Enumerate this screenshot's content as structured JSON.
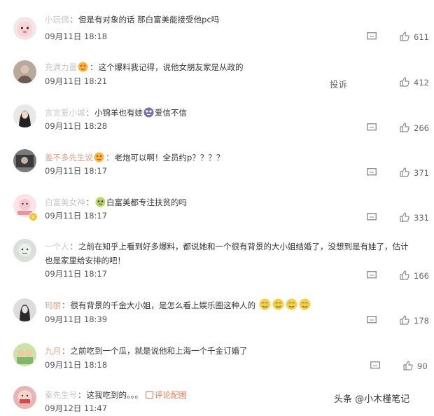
{
  "comments": [
    {
      "user": "小玩偶",
      "text": "但是有对象的话 那白富美能接受他pc吗",
      "time": "09月11日 18:18",
      "likes": "611"
    },
    {
      "user": "充满力量",
      "text": "这个爆料我记得，说他女朋友家是从政的",
      "time": "09月11日 18:21",
      "likes": "412",
      "report": "投诉"
    },
    {
      "user": "言言爱小城",
      "text_a": "小锦羊也有娃",
      "text_b": "爱信不信",
      "time": "09月11日 18:28",
      "likes": "266"
    },
    {
      "user": "差不多先生说",
      "text": "老炮可以啊！全员约p？？？？",
      "time": "09月11日 18:17",
      "likes": "371"
    },
    {
      "user": "白富美女神",
      "text": "白富美都专注扶贫的吗",
      "time": "09月11日 18:17",
      "likes": "331"
    },
    {
      "user": "一个人",
      "text": "之前在知乎上看到好多爆料，都说她和一个很有背景的大小姐结婚了，没想到是有娃了，估计也是家里给安排的吧！",
      "time": "09月11日 18:17",
      "likes": "166"
    },
    {
      "user": "玛丽",
      "text": "很有背景的千金大小姐，是怎么看上娱乐圈这种人的",
      "time": "09月11日 18:39",
      "likes": "178"
    },
    {
      "user": "九月",
      "text": "之前吃到一个瓜，就是说他和上海一个千金订婚了",
      "time": "09月11日 18:18",
      "likes": "90"
    },
    {
      "user": "秦先生号",
      "text": "这我吃到的。。。",
      "link": "评论配图",
      "time": "09月12日 11:47",
      "likes": ""
    }
  ],
  "watermark": "头条 @小木槿笔记",
  "icons": {
    "reply": "reply-icon",
    "like": "thumbs-up-icon",
    "emoji": "emoji-icon"
  }
}
